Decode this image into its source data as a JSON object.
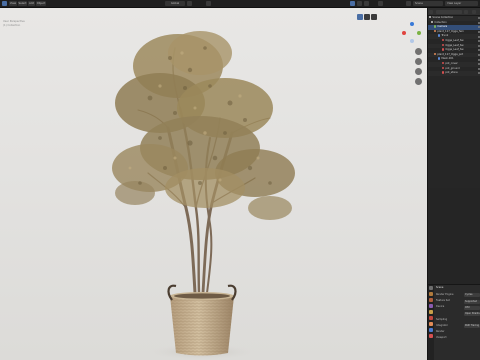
{
  "app": {
    "title": "Scene",
    "view_layer": "View Layer",
    "editor_menus": [
      "View",
      "Select",
      "Add",
      "Object"
    ],
    "viewport_mode": "Global"
  },
  "viewport": {
    "info_lines": [
      "User Perspective",
      "(1) Collection"
    ],
    "accent_active": "#4a6ea4",
    "gizmo_colors": {
      "x": "#e0443f",
      "y": "#7bb243",
      "z": "#3a7ad8"
    }
  },
  "outliner": {
    "header_label": "Scene Collection",
    "rows": [
      {
        "label": "Scene Collection",
        "icon": "collection-icon",
        "color": "#cfcfcf",
        "selected": false
      },
      {
        "label": "Collection",
        "icon": "collection-icon",
        "color": "#cfcfcf",
        "selected": false
      },
      {
        "label": "Camera",
        "icon": "camera-icon",
        "color": "#7ab55c",
        "selected": true
      },
      {
        "label": "plant_117_Ogga_fern",
        "icon": "mesh-icon",
        "color": "#e18b57",
        "selected": false
      },
      {
        "label": "Trunk",
        "icon": "modifier-icon",
        "color": "#5a8ad8",
        "selected": false
      },
      {
        "label": "Ogga_Leaf_Sw",
        "icon": "material-icon",
        "color": "#d45050",
        "selected": false
      },
      {
        "label": "Ogga_Leaf_Sw",
        "icon": "material-icon",
        "color": "#d45050",
        "selected": false
      },
      {
        "label": "Ogga_Leaf_Sw",
        "icon": "material-icon",
        "color": "#d45050",
        "selected": false
      },
      {
        "label": "plant_117_Ogga_pot",
        "icon": "mesh-icon",
        "color": "#e18b57",
        "selected": false
      },
      {
        "label": "Mesh.001",
        "icon": "modifier-icon",
        "color": "#5a8ad8",
        "selected": false
      },
      {
        "label": "pot_cover",
        "icon": "material-icon",
        "color": "#d45050",
        "selected": false
      },
      {
        "label": "pot_ground",
        "icon": "material-icon",
        "color": "#d45050",
        "selected": false
      },
      {
        "label": "pot_stone",
        "icon": "material-icon",
        "color": "#d45050",
        "selected": false
      }
    ]
  },
  "properties": {
    "title": "Scene",
    "rows": [
      {
        "label": "Render Engine",
        "value": "Cycles"
      },
      {
        "label": "Feature Set",
        "value": "Supported"
      },
      {
        "label": "Device",
        "value": "CPU"
      },
      {
        "label": "",
        "value": "Open Shading Language"
      },
      {
        "label": "Sampling",
        "value": ""
      },
      {
        "label": "Integrator",
        "value": "Path Tracing"
      },
      {
        "label": "Render",
        "value": ""
      },
      {
        "label": "Viewport",
        "value": ""
      }
    ]
  }
}
